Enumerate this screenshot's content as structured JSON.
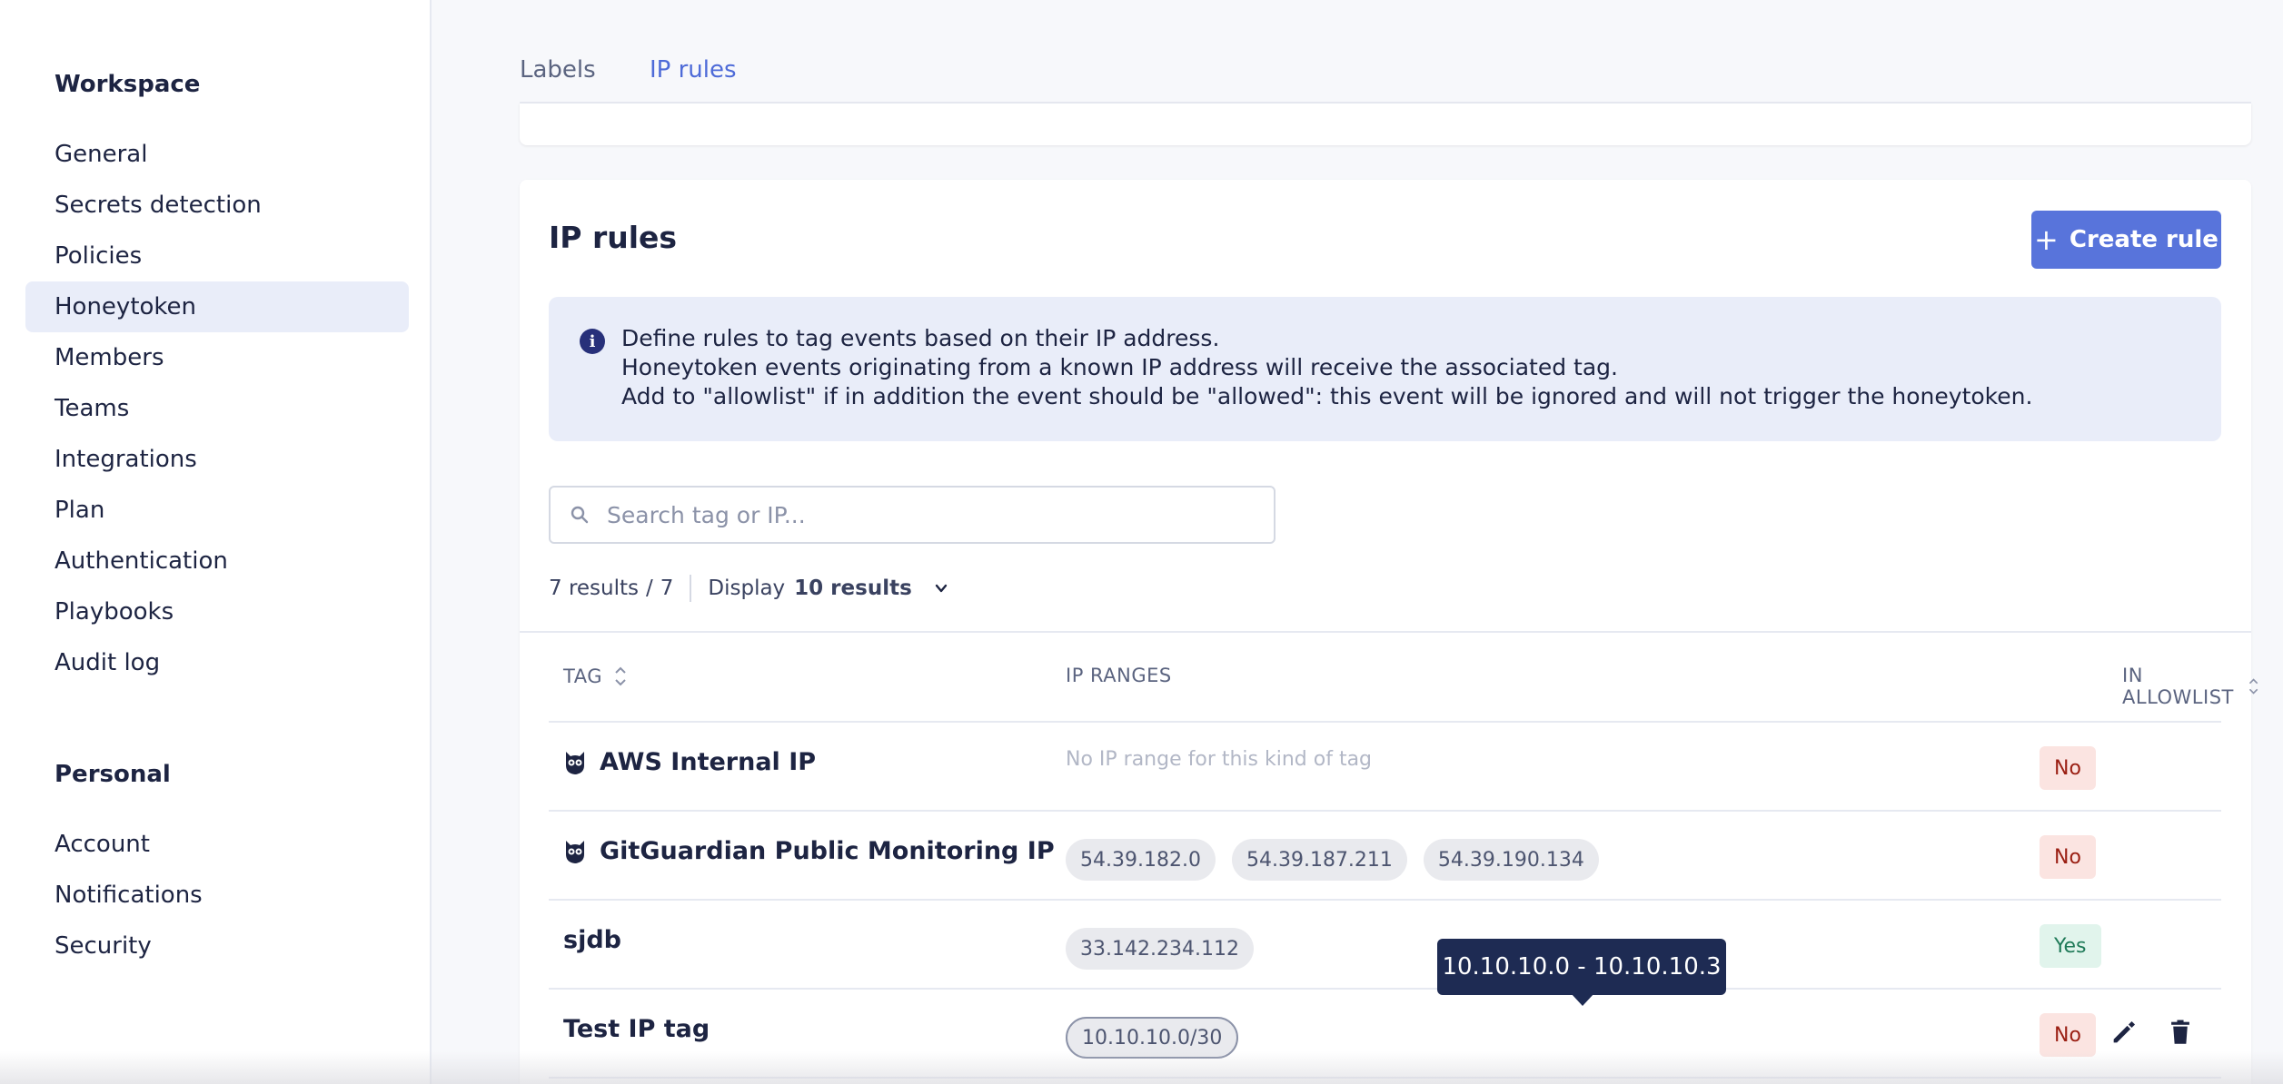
{
  "sidebar": {
    "workspace_heading": "Workspace",
    "workspace_items": [
      "General",
      "Secrets detection",
      "Policies",
      "Honeytoken",
      "Members",
      "Teams",
      "Integrations",
      "Plan",
      "Authentication",
      "Playbooks",
      "Audit log"
    ],
    "active_item": "Honeytoken",
    "personal_heading": "Personal",
    "personal_items": [
      "Account",
      "Notifications",
      "Security"
    ]
  },
  "tabs": [
    {
      "label": "Labels",
      "active": false
    },
    {
      "label": "IP rules",
      "active": true
    }
  ],
  "card": {
    "title": "IP rules",
    "create_button": "Create rule",
    "info_lines": [
      "Define rules to tag events based on their IP address.",
      "Honeytoken events originating from a known IP address will receive the associated tag.",
      "Add to \"allowlist\" if in addition the event should be \"allowed\": this event will be ignored and will not trigger the honeytoken."
    ],
    "search": {
      "placeholder": "Search tag or IP...",
      "value": ""
    },
    "results": {
      "count": "7 results",
      "separator": "/",
      "total": "7",
      "display_label": "Display",
      "display_value": "10 results"
    },
    "table": {
      "headers": {
        "tag": "TAG",
        "ip_ranges": "IP RANGES",
        "in_allowlist": "IN ALLOWLIST"
      },
      "rows": [
        {
          "tag": "AWS Internal IP",
          "icon": "owl-icon",
          "empty_text": "No IP range for this kind of tag",
          "ips": [],
          "allowlist": "No"
        },
        {
          "tag": "GitGuardian Public Monitoring IP",
          "icon": "owl-icon",
          "empty_text": "",
          "ips": [
            "54.39.182.0",
            "54.39.187.211",
            "54.39.190.134"
          ],
          "allowlist": "No"
        },
        {
          "tag": "sjdb",
          "icon": "",
          "empty_text": "",
          "ips": [
            "33.142.234.112"
          ],
          "allowlist": "Yes"
        },
        {
          "tag": "Test IP tag",
          "icon": "",
          "empty_text": "",
          "ips": [
            "10.10.10.0/30"
          ],
          "allowlist": "No"
        }
      ]
    },
    "tooltip": "10.10.10.0 - 10.10.10.3"
  },
  "colors": {
    "accent": "#4e6bd8",
    "button": "#5874db",
    "no_badge_bg": "#fbe4e1",
    "no_badge_text": "#9a1e12",
    "yes_badge_bg": "#e1f4ec",
    "yes_badge_text": "#1f7a58",
    "tooltip_bg": "#1e2b53"
  }
}
